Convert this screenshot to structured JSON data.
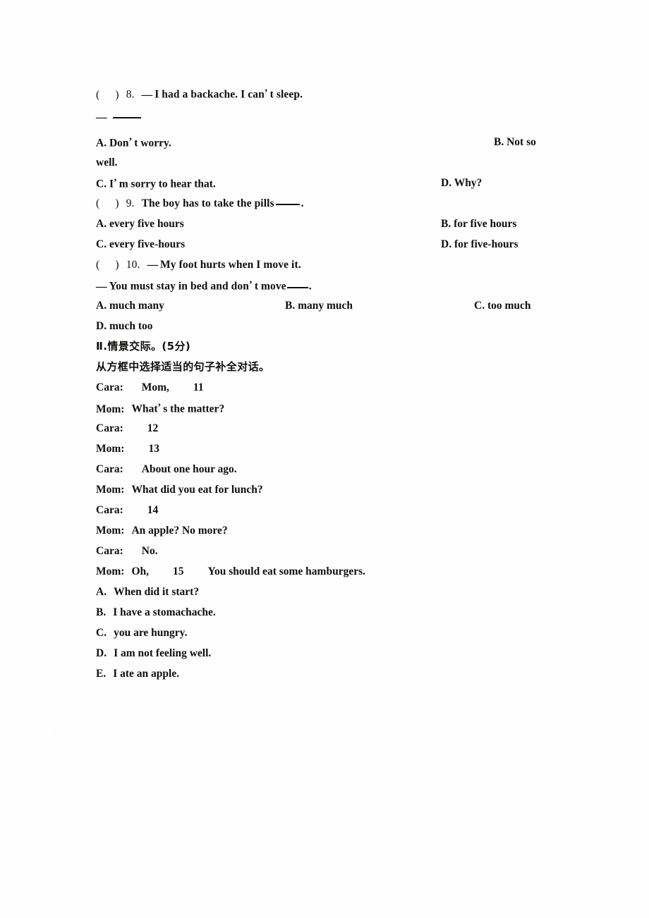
{
  "document": {
    "type": "english-exam-worksheet",
    "background_color": "#fefefe",
    "text_color": "#100f0d"
  },
  "questions": [
    {
      "id": "q8",
      "marker_open": "(",
      "marker_close": ")",
      "number": "8.",
      "stem_line1": "I had a backache. I can",
      "stem_line1_after_apos": "t sleep.",
      "dash": "—",
      "apostrophe": "’",
      "options": [
        {
          "key": "A.",
          "text": "Don",
          "after_apos": "t worry.",
          "has_apos": true
        },
        {
          "key": "B.",
          "text": "Not so",
          "has_apos": false
        },
        {
          "key": "C.",
          "text": "I",
          "after_apos": "m sorry to hear that.",
          "has_apos": true
        },
        {
          "key": "D.",
          "text": "Why?",
          "has_apos": false
        }
      ],
      "wrap_text": "well."
    },
    {
      "id": "q9",
      "marker_open": "(",
      "marker_close": ")",
      "number": "9.",
      "stem_before_blank": "The boy has to take the pills",
      "stem_after_blank": ".",
      "options": [
        {
          "key": "A.",
          "text": "every five hours"
        },
        {
          "key": "B.",
          "text": "for five hours"
        },
        {
          "key": "C.",
          "text": "every five-hours"
        },
        {
          "key": "D.",
          "text": "for five-hours"
        }
      ]
    },
    {
      "id": "q10",
      "marker_open": "(",
      "marker_close": ")",
      "number": "10.",
      "dash": "—",
      "stem_line1": "My foot hurts when I move it.",
      "stem_line2_before": "You must stay in bed and don",
      "stem_line2_after_apos": "t move",
      "stem_line2_end": ".",
      "options": [
        {
          "key": "A.",
          "text": "much many"
        },
        {
          "key": "B.",
          "text": "many much"
        },
        {
          "key": "C.",
          "text": "too much"
        },
        {
          "key": "D.",
          "text": "much too"
        }
      ]
    }
  ],
  "section2": {
    "heading": "Ⅱ.情景交际。(5分)",
    "instruction": "从方框中选择适当的句子补全对话。",
    "dialogue": [
      {
        "speaker": "Cara:",
        "text": "Mom,",
        "blank": "11",
        "tail": ""
      },
      {
        "speaker": "Mom:",
        "text": "What",
        "apos": true,
        "after_apos": "s the matter?",
        "blank": "",
        "tail": ""
      },
      {
        "speaker": "Cara:",
        "text": "",
        "blank": "12",
        "tail": ""
      },
      {
        "speaker": "Mom:",
        "text": "",
        "blank": "13",
        "tail": ""
      },
      {
        "speaker": "Cara:",
        "text": "About one hour ago.",
        "blank": "",
        "tail": ""
      },
      {
        "speaker": "Mom:",
        "text": "What did you eat for lunch?",
        "blank": "",
        "tail": ""
      },
      {
        "speaker": "Cara:",
        "text": "",
        "blank": "14",
        "tail": ""
      },
      {
        "speaker": "Mom:",
        "text": "An apple? No more?",
        "blank": "",
        "tail": ""
      },
      {
        "speaker": "Cara:",
        "text": "No.",
        "blank": "",
        "tail": ""
      },
      {
        "speaker": "Mom:",
        "text": "Oh,",
        "blank": "15",
        "tail": "You should eat some hamburgers."
      }
    ],
    "choices": [
      {
        "key": "A.",
        "text": "When did it start?"
      },
      {
        "key": "B.",
        "text": "I have a stomachache."
      },
      {
        "key": "C.",
        "text": "you are hungry."
      },
      {
        "key": "D.",
        "text": "I am not feeling well."
      },
      {
        "key": "E.",
        "text": "I ate an apple."
      }
    ]
  }
}
